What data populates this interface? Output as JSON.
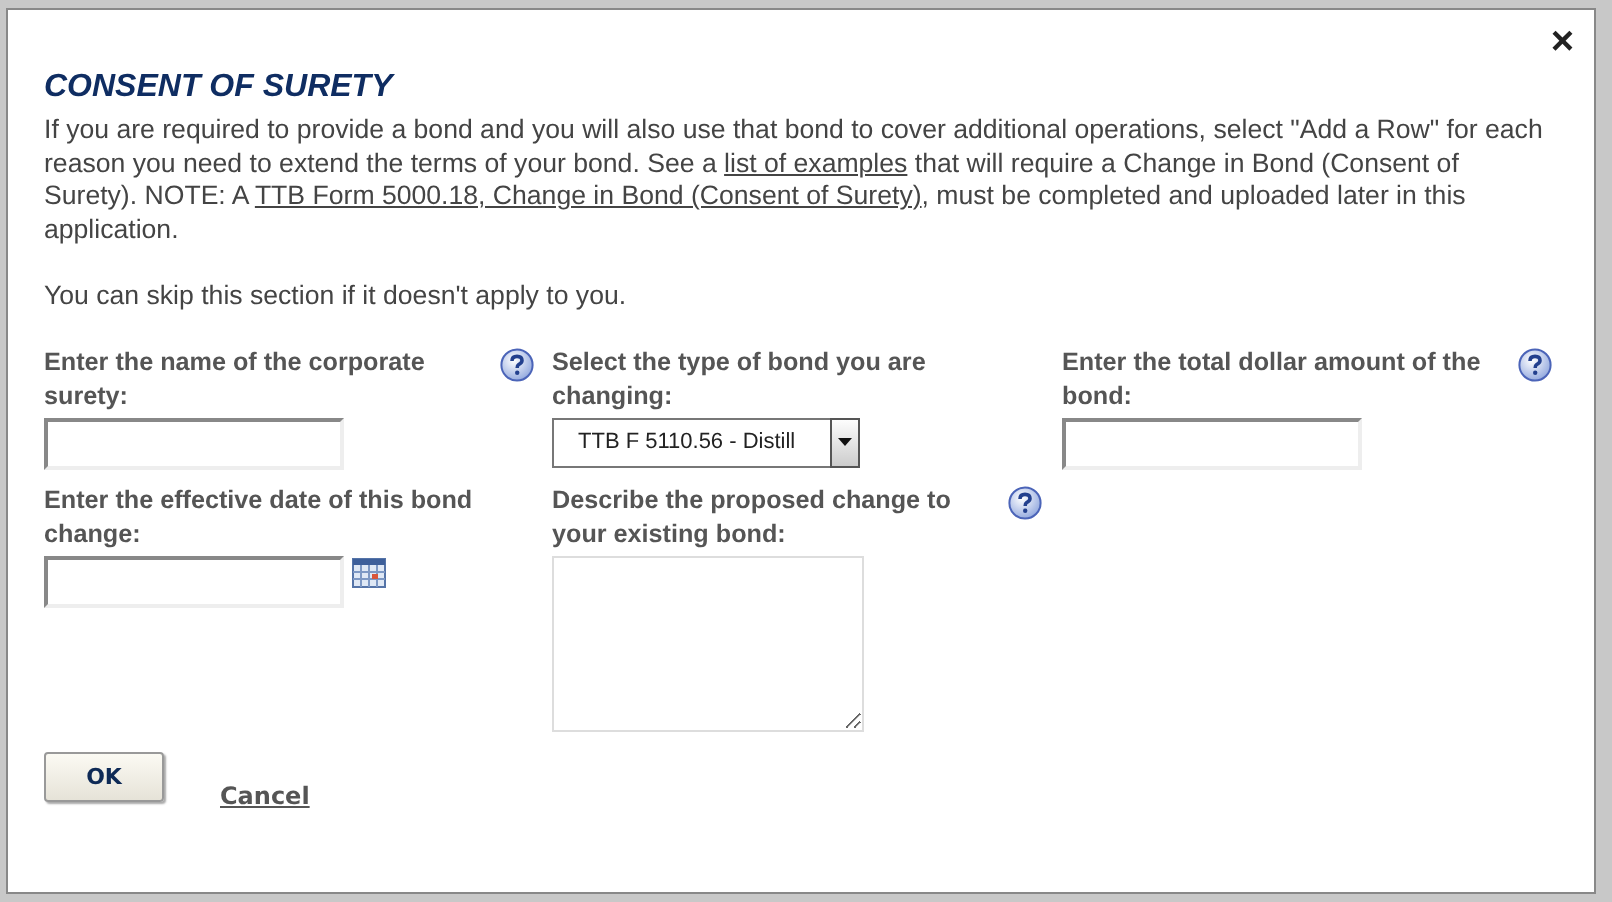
{
  "dialog": {
    "title": "CONSENT OF SURETY",
    "close": "×",
    "intro": [
      {
        "kind": "text",
        "text": "If you are required to provide a bond and you will also use that bond to cover additional operations, select \"Add a Row\" for each reason you need to extend the terms of your bond. See a "
      },
      {
        "kind": "link",
        "text": "list of examples"
      },
      {
        "kind": "text",
        "text": " that will require a Change in Bond (Consent of Surety). NOTE: A "
      },
      {
        "kind": "link",
        "text": "TTB Form 5000.18, Change in Bond (Consent of Surety)"
      },
      {
        "kind": "text",
        "text": ", must be completed and uploaded later in this application."
      }
    ],
    "skip_note": "You can skip this section if it doesn't apply to you.",
    "fields": [
      {
        "kind": "text",
        "label": "Enter the name of the corporate surety:",
        "help": true
      },
      {
        "kind": "select",
        "label": "Select the type of bond you are changing:",
        "help": false,
        "value": "TTB F 5110.56 - Distill"
      },
      {
        "kind": "text",
        "label": "Enter the total dollar amount of the bond:",
        "help": true
      },
      {
        "kind": "date",
        "label": "Enter the effective date of this bond change:",
        "help": false
      },
      {
        "kind": "textarea",
        "label": "Describe the proposed change to your existing bond:",
        "help": true
      }
    ],
    "buttons": [
      {
        "kind": "button",
        "label": "OK"
      },
      {
        "kind": "link",
        "label": "Cancel"
      }
    ]
  }
}
